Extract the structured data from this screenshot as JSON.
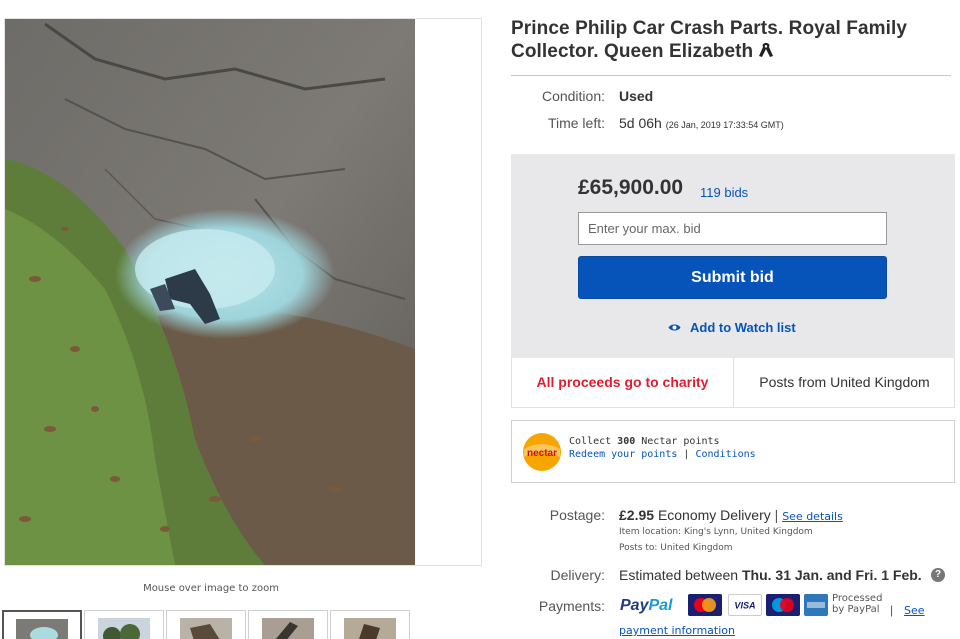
{
  "gallery": {
    "zoom_hint": "Mouse over image to zoom",
    "main_image": "photo of broken blue glass and debris on asphalt next to grass verge with fallen leaves",
    "thumbnails": [
      "glass-debris-thumb",
      "trees-thumb",
      "debris-thumb",
      "car-part-thumb",
      "debris-close-thumb"
    ]
  },
  "listing": {
    "title": "Prince Philip Car Crash Parts. Royal Family Collector. Queen Elizabeth",
    "title_icon": "black-ribbon-icon",
    "condition_label": "Condition:",
    "condition_value": "Used",
    "time_left_label": "Time left:",
    "time_left_value": "5d 06h",
    "time_left_date": "(26 Jan, 2019   17:33:54 GMT)"
  },
  "bidding": {
    "price": "£65,900.00",
    "bids": "119 bids",
    "input_placeholder": "Enter your max. bid",
    "submit_label": "Submit bid",
    "watch_label": "Add to Watch list",
    "charity_text": "All proceeds go to charity",
    "posts_from": "Posts from United Kingdom"
  },
  "nectar": {
    "logo_text": "nectar",
    "collect_prefix": "Collect ",
    "points": "300",
    "collect_suffix": " Nectar points",
    "redeem_link": "Redeem your points",
    "separator": "|",
    "conditions_link": "Conditions"
  },
  "shipping": {
    "postage_label": "Postage:",
    "postage_price": "£2.95",
    "postage_service": "Economy Delivery",
    "separator": "|",
    "see_details": "See details",
    "item_location": "Item location:  King's Lynn, United Kingdom",
    "posts_to": "Posts to:  United Kingdom",
    "delivery_label": "Delivery:",
    "delivery_prefix": "Estimated between ",
    "delivery_dates": "Thu. 31 Jan. and Fri. 1 Feb.",
    "help_glyph": "?"
  },
  "payments": {
    "label": "Payments:",
    "paypal_pay": "Pay",
    "paypal_pal": "Pal",
    "cards": [
      "MasterCard",
      "VISA",
      "Maestro",
      "AMEX"
    ],
    "processed_line1": "Processed",
    "processed_line2": "by PayPal",
    "separator": "|",
    "see_link": "See",
    "payment_info_link": "payment information"
  },
  "colors": {
    "link_blue": "#0654ba",
    "charity_red": "#dd1e31",
    "bid_panel_bg": "#e8e8ea",
    "nectar_orange": "#f7a600"
  }
}
